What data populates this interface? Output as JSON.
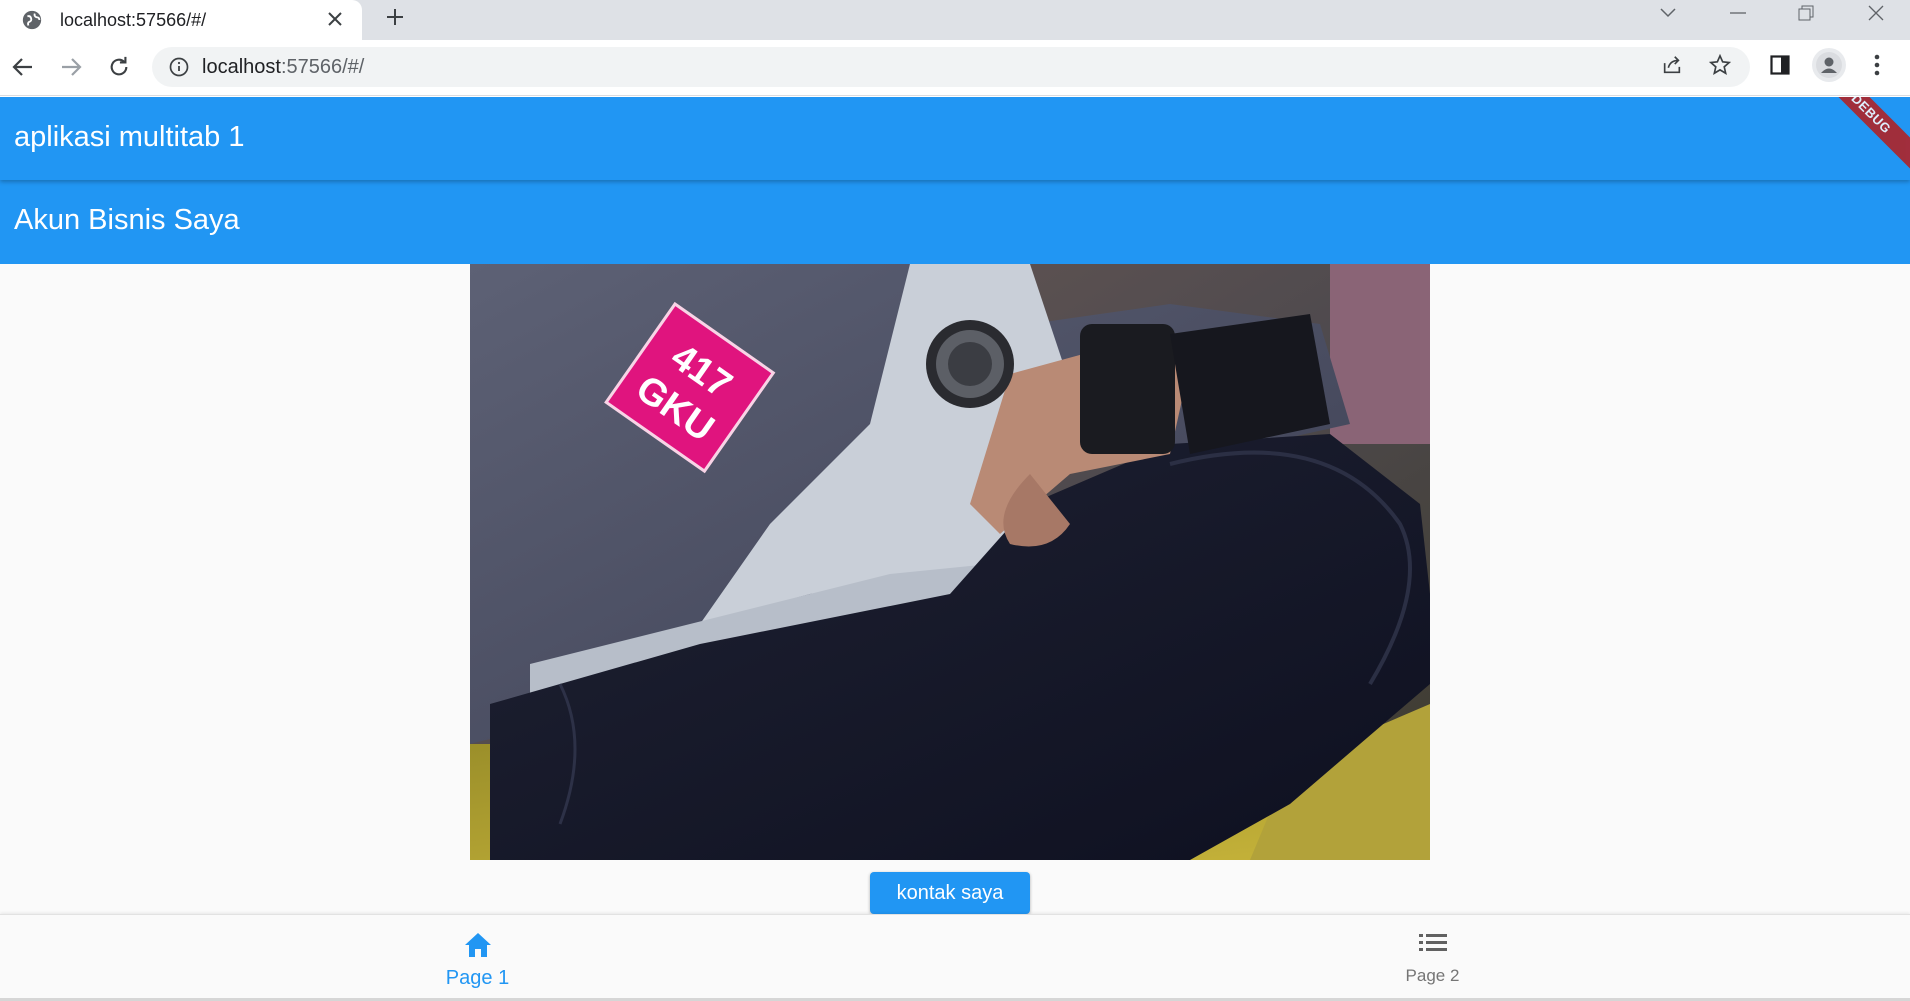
{
  "browser": {
    "tab_title": "localhost:57566/#/",
    "url_host": "localhost",
    "url_path": ":57566/#/"
  },
  "app": {
    "appbar_title": "aplikasi multitab 1",
    "sub_title": "Akun Bisnis Saya",
    "debug_banner": "DEBUG",
    "contact_button": "kontak saya",
    "photo_patch_text": [
      "417",
      "GKU"
    ],
    "bottom_nav": [
      {
        "label": "Page 1",
        "icon": "home-icon",
        "active": true
      },
      {
        "label": "Page 2",
        "icon": "list-icon",
        "active": false
      }
    ]
  },
  "colors": {
    "primary": "#2196f3",
    "debug": "#b71c1c",
    "inactive": "#757575"
  }
}
